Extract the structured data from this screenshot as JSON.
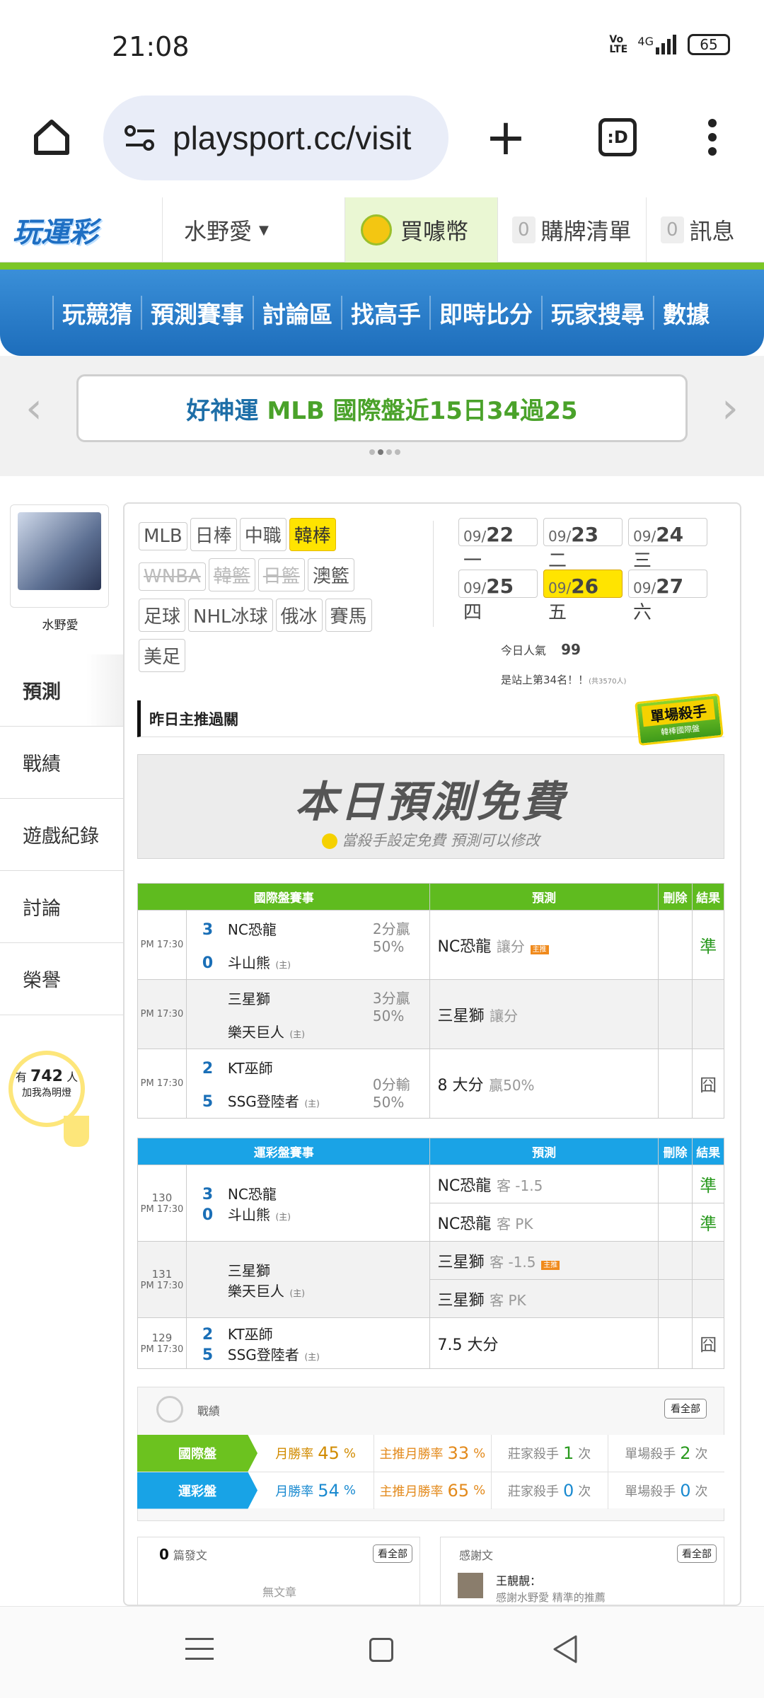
{
  "status": {
    "time": "21:08",
    "volte": "Vo LTE",
    "net": "4G",
    "battery": "65"
  },
  "browser": {
    "url": "playsport.cc/visit"
  },
  "site": {
    "logo": "玩運彩",
    "user": "水野愛",
    "coin": "買噱幣",
    "cart_count": "0",
    "cart": "購牌清單",
    "msg_count": "0",
    "msg": "訊息"
  },
  "nav": [
    "玩競猜",
    "預測賽事",
    "討論區",
    "找高手",
    "即時比分",
    "玩家搜尋",
    "數據"
  ],
  "banner": {
    "part1": "好神運",
    "part2": "MLB 國際盤近15日34過25"
  },
  "profile": {
    "name": "水野愛"
  },
  "sidebar": [
    "預測",
    "戰績",
    "遊戲紀錄",
    "討論",
    "榮譽"
  ],
  "fans": {
    "pre": "有",
    "count": "742",
    "unit": "人",
    "sub": "加我為明燈"
  },
  "sports": [
    {
      "label": "MLB",
      "state": ""
    },
    {
      "label": "日棒",
      "state": ""
    },
    {
      "label": "中職",
      "state": ""
    },
    {
      "label": "韓棒",
      "state": "act"
    },
    {
      "label": "WNBA",
      "state": "dis"
    },
    {
      "label": "韓籃",
      "state": "dis"
    },
    {
      "label": "日籃",
      "state": "dis"
    },
    {
      "label": "澳籃",
      "state": ""
    },
    {
      "label": "足球",
      "state": ""
    },
    {
      "label": "NHL冰球",
      "state": ""
    },
    {
      "label": "俄冰",
      "state": ""
    },
    {
      "label": "賽馬",
      "state": ""
    },
    {
      "label": "美足",
      "state": ""
    }
  ],
  "dates": [
    {
      "m": "09/",
      "d": "22",
      "w": "一"
    },
    {
      "m": "09/",
      "d": "23",
      "w": "二"
    },
    {
      "m": "09/",
      "d": "24",
      "w": "三"
    },
    {
      "m": "09/",
      "d": "25",
      "w": "四"
    },
    {
      "m": "09/",
      "d": "26",
      "w": "五",
      "act": true
    },
    {
      "m": "09/",
      "d": "27",
      "w": "六"
    }
  ],
  "popularity": {
    "label": "今日人氣",
    "value": "99",
    "rank": "是站上第34名！！",
    "sub": "(共3570人)"
  },
  "yesterday": "昨日主推過關",
  "killer_badge": {
    "title": "單場殺手",
    "sub": "韓棒國際盤"
  },
  "free": {
    "title": "本日預測免費",
    "sub": "當殺手設定免費 預測可以修改"
  },
  "intl": {
    "h1": "國際盤賽事",
    "h2": "預測",
    "h3": "刪除",
    "h4": "結果",
    "rows": [
      {
        "time": "PM 17:30",
        "s1": "3",
        "t1": "NC恐龍",
        "s2": "0",
        "t2": "斗山熊",
        "home2": "(主)",
        "line": "2分贏",
        "pct": "50%",
        "pick": "NC恐龍",
        "type": "讓分",
        "main": "主推",
        "result": "準"
      },
      {
        "time": "PM 17:30",
        "s1": "",
        "t1": "三星獅",
        "s2": "",
        "t2": "樂天巨人",
        "home2": "(主)",
        "line": "3分贏",
        "pct": "50%",
        "pick": "三星獅",
        "type": "讓分",
        "main": "",
        "result": ""
      },
      {
        "time": "PM 17:30",
        "s1": "2",
        "t1": "KT巫師",
        "s2": "5",
        "t2": "SSG登陸者",
        "home2": "(主)",
        "line": "0分輸",
        "pct": "50%",
        "pick": "8 大分",
        "type": "贏50%",
        "main": "",
        "result": "囧"
      }
    ]
  },
  "lottery": {
    "h1": "運彩盤賽事",
    "h2": "預測",
    "h3": "刪除",
    "h4": "結果",
    "rows": [
      {
        "no": "130",
        "time": "PM 17:30",
        "s1": "3",
        "t1": "NC恐龍",
        "s2": "0",
        "t2": "斗山熊",
        "home2": "(主)",
        "p1": "NC恐龍",
        "p1t": "客 -1.5",
        "r1": "準",
        "p2": "NC恐龍",
        "p2t": "客 PK",
        "r2": "準",
        "main": ""
      },
      {
        "no": "131",
        "time": "PM 17:30",
        "s1": "",
        "t1": "三星獅",
        "s2": "",
        "t2": "樂天巨人",
        "home2": "(主)",
        "p1": "三星獅",
        "p1t": "客 -1.5",
        "r1": "",
        "p2": "三星獅",
        "p2t": "客 PK",
        "r2": "",
        "main": "主推"
      },
      {
        "no": "129",
        "time": "PM 17:30",
        "s1": "2",
        "t1": "KT巫師",
        "s2": "5",
        "t2": "SSG登陸者",
        "home2": "(主)",
        "p1": "7.5 大分",
        "p1t": "",
        "r1": "囧"
      }
    ]
  },
  "record": {
    "title": "戰績",
    "all": "看全部",
    "intl": {
      "label": "國際盤",
      "m_rate": "月勝率",
      "m_val": "45",
      "main_rate": "主推月勝率",
      "main_val": "33",
      "pct": "%",
      "dealer": "莊家殺手",
      "dealer_val": "1",
      "times": "次",
      "single": "單場殺手",
      "single_val": "2"
    },
    "lot": {
      "label": "運彩盤",
      "m_rate": "月勝率",
      "m_val": "54",
      "main_rate": "主推月勝率",
      "main_val": "65",
      "pct": "%",
      "dealer": "莊家殺手",
      "dealer_val": "0",
      "times": "次",
      "single": "單場殺手",
      "single_val": "0"
    }
  },
  "posts": {
    "count": "0",
    "label": "篇發文",
    "all": "看全部",
    "empty": "無文章"
  },
  "thanks": {
    "label": "感謝文",
    "all": "看全部",
    "user": "王靚靚：",
    "text": "感謝水野愛 精準的推薦"
  }
}
